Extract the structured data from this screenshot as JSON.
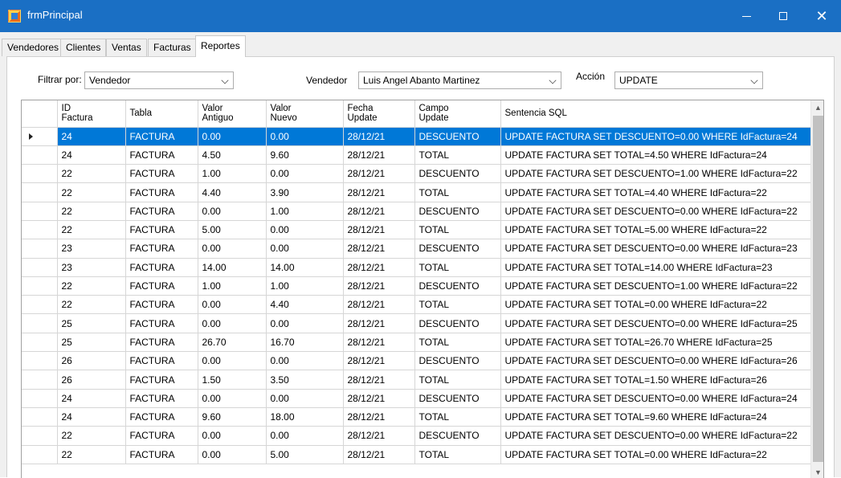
{
  "window": {
    "title": "frmPrincipal",
    "minimize_icon": "minimize-icon",
    "maximize_icon": "maximize-icon",
    "close_icon": "close-icon",
    "close_glyph": "✕"
  },
  "tabs": [
    {
      "label": "Vendedores",
      "active": false
    },
    {
      "label": "Clientes",
      "active": false
    },
    {
      "label": "Ventas",
      "active": false
    },
    {
      "label": "Facturas",
      "active": false
    },
    {
      "label": "Reportes",
      "active": true
    }
  ],
  "filters": {
    "filtrar_label": "Filtrar por:",
    "filtrar_value": "Vendedor",
    "vendedor_label": "Vendedor",
    "vendedor_value": "Luis Angel Abanto Martinez",
    "accion_label": "Acción",
    "accion_value": "UPDATE"
  },
  "grid": {
    "columns": [
      {
        "line1": "ID",
        "line2": "Factura"
      },
      {
        "line1": "Tabla",
        "line2": ""
      },
      {
        "line1": "Valor",
        "line2": "Antiguo"
      },
      {
        "line1": "Valor",
        "line2": "Nuevo"
      },
      {
        "line1": "Fecha",
        "line2": "Update"
      },
      {
        "line1": "Campo",
        "line2": "Update"
      },
      {
        "line1": "Sentencia SQL",
        "line2": ""
      }
    ],
    "selected_row": 0,
    "rows": [
      [
        "24",
        "FACTURA",
        "0.00",
        "0.00",
        "28/12/21",
        "DESCUENTO",
        "UPDATE FACTURA SET DESCUENTO=0.00 WHERE IdFactura=24"
      ],
      [
        "24",
        "FACTURA",
        "4.50",
        "9.60",
        "28/12/21",
        "TOTAL",
        "UPDATE FACTURA SET TOTAL=4.50 WHERE IdFactura=24"
      ],
      [
        "22",
        "FACTURA",
        "1.00",
        "0.00",
        "28/12/21",
        "DESCUENTO",
        "UPDATE FACTURA SET DESCUENTO=1.00 WHERE IdFactura=22"
      ],
      [
        "22",
        "FACTURA",
        "4.40",
        "3.90",
        "28/12/21",
        "TOTAL",
        "UPDATE FACTURA SET TOTAL=4.40 WHERE IdFactura=22"
      ],
      [
        "22",
        "FACTURA",
        "0.00",
        "1.00",
        "28/12/21",
        "DESCUENTO",
        "UPDATE FACTURA SET DESCUENTO=0.00 WHERE IdFactura=22"
      ],
      [
        "22",
        "FACTURA",
        "5.00",
        "0.00",
        "28/12/21",
        "TOTAL",
        "UPDATE FACTURA SET TOTAL=5.00 WHERE IdFactura=22"
      ],
      [
        "23",
        "FACTURA",
        "0.00",
        "0.00",
        "28/12/21",
        "DESCUENTO",
        "UPDATE FACTURA SET DESCUENTO=0.00 WHERE IdFactura=23"
      ],
      [
        "23",
        "FACTURA",
        "14.00",
        "14.00",
        "28/12/21",
        "TOTAL",
        "UPDATE FACTURA SET TOTAL=14.00 WHERE IdFactura=23"
      ],
      [
        "22",
        "FACTURA",
        "1.00",
        "1.00",
        "28/12/21",
        "DESCUENTO",
        "UPDATE FACTURA SET DESCUENTO=1.00 WHERE IdFactura=22"
      ],
      [
        "22",
        "FACTURA",
        "0.00",
        "4.40",
        "28/12/21",
        "TOTAL",
        "UPDATE FACTURA SET TOTAL=0.00 WHERE IdFactura=22"
      ],
      [
        "25",
        "FACTURA",
        "0.00",
        "0.00",
        "28/12/21",
        "DESCUENTO",
        "UPDATE FACTURA SET DESCUENTO=0.00 WHERE IdFactura=25"
      ],
      [
        "25",
        "FACTURA",
        "26.70",
        "16.70",
        "28/12/21",
        "TOTAL",
        "UPDATE FACTURA SET TOTAL=26.70 WHERE IdFactura=25"
      ],
      [
        "26",
        "FACTURA",
        "0.00",
        "0.00",
        "28/12/21",
        "DESCUENTO",
        "UPDATE FACTURA SET DESCUENTO=0.00 WHERE IdFactura=26"
      ],
      [
        "26",
        "FACTURA",
        "1.50",
        "3.50",
        "28/12/21",
        "TOTAL",
        "UPDATE FACTURA SET TOTAL=1.50 WHERE IdFactura=26"
      ],
      [
        "24",
        "FACTURA",
        "0.00",
        "0.00",
        "28/12/21",
        "DESCUENTO",
        "UPDATE FACTURA SET DESCUENTO=0.00 WHERE IdFactura=24"
      ],
      [
        "24",
        "FACTURA",
        "9.60",
        "18.00",
        "28/12/21",
        "TOTAL",
        "UPDATE FACTURA SET TOTAL=9.60 WHERE IdFactura=24"
      ],
      [
        "22",
        "FACTURA",
        "0.00",
        "0.00",
        "28/12/21",
        "DESCUENTO",
        "UPDATE FACTURA SET DESCUENTO=0.00 WHERE IdFactura=22"
      ],
      [
        "22",
        "FACTURA",
        "0.00",
        "5.00",
        "28/12/21",
        "TOTAL",
        "UPDATE FACTURA SET TOTAL=0.00 WHERE IdFactura=22"
      ]
    ]
  },
  "colors": {
    "titlebar": "#1a6fc4",
    "selection": "#0078d7",
    "window_bg": "#f0f0f0"
  }
}
